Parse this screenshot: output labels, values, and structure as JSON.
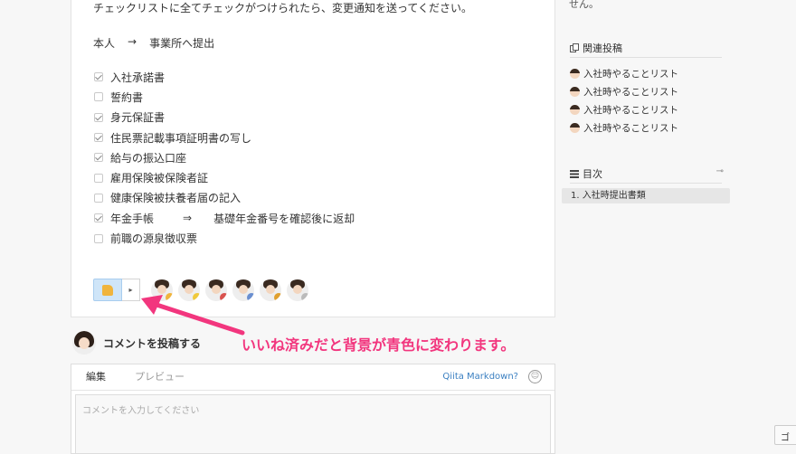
{
  "article": {
    "intro_text": "チェックリストに全てチェックがつけられたら、変更通知を送ってください。",
    "route": {
      "from": "本人",
      "arrow": "→",
      "to": "事業所へ提出"
    },
    "checklist": [
      {
        "label": "入社承諾書",
        "checked": true
      },
      {
        "label": "誓約書",
        "checked": false
      },
      {
        "label": "身元保証書",
        "checked": true
      },
      {
        "label": "住民票記載事項証明書の写し",
        "checked": true
      },
      {
        "label": "給与の振込口座",
        "checked": true
      },
      {
        "label": "雇用保険被保険者証",
        "checked": false
      },
      {
        "label": "健康保険被扶養者届の記入",
        "checked": false
      },
      {
        "label": "年金手帳",
        "checked": true,
        "arrow": "⇒",
        "note": "基礎年金番号を確認後に返却"
      },
      {
        "label": "前職の源泉徴収票",
        "checked": false
      }
    ]
  },
  "reactions": {
    "like_active_color": "#cfe5f8",
    "caret": "▸",
    "badges": [
      "#f0b43c",
      "#f0c93c",
      "#d9534f",
      "#6a8fd0",
      "#e0a030",
      "#bbbbbb"
    ]
  },
  "comment": {
    "title": "コメントを投稿する",
    "tabs": [
      "編集",
      "プレビュー"
    ],
    "markdown_link": "Qiita Markdown?",
    "placeholder": "コメントを入力してください"
  },
  "sidebar": {
    "top_text": "せん。",
    "related_title": "関連投稿",
    "related_items": [
      "入社時やることリスト",
      "入社時やることリスト",
      "入社時やることリスト",
      "入社時やることリスト"
    ],
    "toc_title": "目次",
    "toc_items": [
      "1. 入社時提出書類"
    ]
  },
  "annotation": {
    "text": "いいね済みだと背景が青色に変わります。",
    "color": "#f2367e"
  },
  "edge_button_label": "ゴ"
}
